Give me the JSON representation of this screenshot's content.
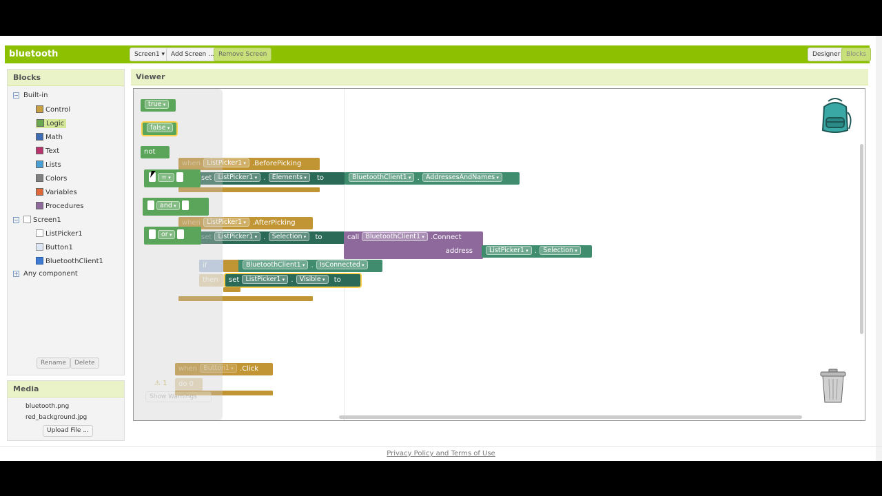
{
  "header": {
    "project_title": "bluetooth",
    "screen_select": "Screen1",
    "add_screen": "Add Screen ...",
    "remove_screen": "Remove Screen",
    "designer": "Designer",
    "blocks": "Blocks",
    "accent": "#8cc000"
  },
  "blocks_panel": {
    "title": "Blocks",
    "builtin": "Built-in",
    "items": [
      {
        "label": "Control",
        "color": "#c8a042"
      },
      {
        "label": "Logic",
        "color": "#6aa84f"
      },
      {
        "label": "Math",
        "color": "#3e6db5"
      },
      {
        "label": "Text",
        "color": "#b8326b"
      },
      {
        "label": "Lists",
        "color": "#4aa0d5"
      },
      {
        "label": "Colors",
        "color": "#808080"
      },
      {
        "label": "Variables",
        "color": "#e0673a"
      },
      {
        "label": "Procedures",
        "color": "#8e6a9c"
      }
    ],
    "screen": "Screen1",
    "components": [
      "ListPicker1",
      "Button1",
      "BluetoothClient1"
    ],
    "any_component": "Any component",
    "rename": "Rename",
    "delete": "Delete"
  },
  "media_panel": {
    "title": "Media",
    "files": [
      "bluetooth.png",
      "red_background.jpg"
    ],
    "upload": "Upload File ..."
  },
  "viewer": {
    "title": "Viewer",
    "flyout": [
      "true",
      "false",
      "not",
      "=",
      "and",
      "or"
    ],
    "warnings_count": "1",
    "show_warnings": "Show Warnings"
  },
  "code": {
    "when": "when",
    "do": "do",
    "set": "set",
    "to": "to",
    "call": "call",
    "if": "if",
    "then": "then",
    "address": "address",
    "listpicker": "ListPicker1",
    "before_picking": ".BeforePicking",
    "after_picking": ".AfterPicking",
    "elements": "Elements",
    "selection": "Selection",
    "visible": "Visible",
    "bt": "BluetoothClient1",
    "addresses": "AddressesAndNames",
    "connect": ".Connect",
    "is_connected": "IsConnected",
    "button": "Button1",
    "click": ".Click",
    "zero": "0"
  },
  "footer": "Privacy Policy and Terms of Use"
}
